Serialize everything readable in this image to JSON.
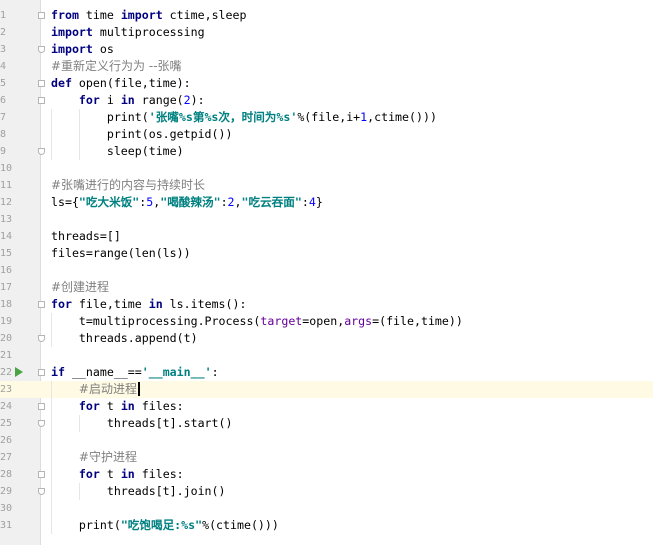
{
  "editor": {
    "lines": [
      {
        "n": "1",
        "tokens": [
          {
            "t": "from",
            "c": "kw"
          },
          {
            "t": " time "
          },
          {
            "t": "import",
            "c": "kw"
          },
          {
            "t": " ctime,sleep"
          }
        ],
        "fold": "start"
      },
      {
        "n": "2",
        "tokens": [
          {
            "t": "import",
            "c": "kw"
          },
          {
            "t": " multiprocessing"
          }
        ]
      },
      {
        "n": "3",
        "tokens": [
          {
            "t": "import",
            "c": "kw"
          },
          {
            "t": " os"
          }
        ],
        "fold": "end"
      },
      {
        "n": "4",
        "tokens": [
          {
            "t": "#重新定义行为为 --张嘴",
            "c": "cmt"
          }
        ]
      },
      {
        "n": "5",
        "tokens": [
          {
            "t": "def",
            "c": "kw"
          },
          {
            "t": " open(file,time):"
          }
        ],
        "fold": "start"
      },
      {
        "n": "6",
        "tokens": [
          {
            "t": "    "
          },
          {
            "t": "for",
            "c": "kw"
          },
          {
            "t": " i "
          },
          {
            "t": "in",
            "c": "kw"
          },
          {
            "t": " range("
          },
          {
            "t": "2",
            "c": "num"
          },
          {
            "t": "):"
          }
        ],
        "fold": "start"
      },
      {
        "n": "7",
        "tokens": [
          {
            "t": "        print("
          },
          {
            "t": "'张嘴%s第%s次，时间为%s'",
            "c": "str"
          },
          {
            "t": "%(file,i+"
          },
          {
            "t": "1",
            "c": "num"
          },
          {
            "t": ",ctime()))"
          }
        ]
      },
      {
        "n": "8",
        "tokens": [
          {
            "t": "        print(os.getpid())"
          }
        ]
      },
      {
        "n": "9",
        "tokens": [
          {
            "t": "        sleep(time)"
          }
        ],
        "fold": "end"
      },
      {
        "n": "10",
        "tokens": []
      },
      {
        "n": "11",
        "tokens": [
          {
            "t": "#张嘴进行的内容与持续时长",
            "c": "cmt"
          }
        ]
      },
      {
        "n": "12",
        "tokens": [
          {
            "t": "ls={"
          },
          {
            "t": "\"吃大米饭\"",
            "c": "str"
          },
          {
            "t": ":"
          },
          {
            "t": "5",
            "c": "num"
          },
          {
            "t": ","
          },
          {
            "t": "\"喝酸辣汤\"",
            "c": "str"
          },
          {
            "t": ":"
          },
          {
            "t": "2",
            "c": "num"
          },
          {
            "t": ","
          },
          {
            "t": "\"吃云吞面\"",
            "c": "str"
          },
          {
            "t": ":"
          },
          {
            "t": "4",
            "c": "num"
          },
          {
            "t": "}"
          }
        ]
      },
      {
        "n": "13",
        "tokens": []
      },
      {
        "n": "14",
        "tokens": [
          {
            "t": "threads=[]"
          }
        ]
      },
      {
        "n": "15",
        "tokens": [
          {
            "t": "files=range(len(ls))"
          }
        ]
      },
      {
        "n": "16",
        "tokens": []
      },
      {
        "n": "17",
        "tokens": [
          {
            "t": "#创建进程",
            "c": "cmt"
          }
        ]
      },
      {
        "n": "18",
        "tokens": [
          {
            "t": "for",
            "c": "kw"
          },
          {
            "t": " file,time "
          },
          {
            "t": "in",
            "c": "kw"
          },
          {
            "t": " ls.items():"
          }
        ],
        "fold": "start"
      },
      {
        "n": "19",
        "tokens": [
          {
            "t": "    t=multiprocessing.Process("
          },
          {
            "t": "target",
            "c": "param"
          },
          {
            "t": "=open,"
          },
          {
            "t": "args",
            "c": "param"
          },
          {
            "t": "=(file,time))"
          }
        ]
      },
      {
        "n": "20",
        "tokens": [
          {
            "t": "    threads.append(t)"
          }
        ],
        "fold": "end"
      },
      {
        "n": "21",
        "tokens": []
      },
      {
        "n": "22",
        "tokens": [
          {
            "t": "if",
            "c": "kw"
          },
          {
            "t": " __name__=="
          },
          {
            "t": "'__main__'",
            "c": "str"
          },
          {
            "t": ":"
          }
        ],
        "run": true,
        "fold": "start"
      },
      {
        "n": "23",
        "tokens": [
          {
            "t": "    "
          },
          {
            "t": "#启动进程",
            "c": "cmt"
          }
        ],
        "current": true,
        "caret": true
      },
      {
        "n": "24",
        "tokens": [
          {
            "t": "    "
          },
          {
            "t": "for",
            "c": "kw"
          },
          {
            "t": " t "
          },
          {
            "t": "in",
            "c": "kw"
          },
          {
            "t": " files:"
          }
        ],
        "fold": "start"
      },
      {
        "n": "25",
        "tokens": [
          {
            "t": "        threads[t].start()"
          }
        ],
        "fold": "end"
      },
      {
        "n": "26",
        "tokens": []
      },
      {
        "n": "27",
        "tokens": [
          {
            "t": "    "
          },
          {
            "t": "#守护进程",
            "c": "cmt"
          }
        ]
      },
      {
        "n": "28",
        "tokens": [
          {
            "t": "    "
          },
          {
            "t": "for",
            "c": "kw"
          },
          {
            "t": " t "
          },
          {
            "t": "in",
            "c": "kw"
          },
          {
            "t": " files:"
          }
        ],
        "fold": "start"
      },
      {
        "n": "29",
        "tokens": [
          {
            "t": "        threads[t].join()"
          }
        ],
        "fold": "end"
      },
      {
        "n": "30",
        "tokens": []
      },
      {
        "n": "31",
        "tokens": [
          {
            "t": "    print("
          },
          {
            "t": "\"吃饱喝足:%s\"",
            "c": "str"
          },
          {
            "t": "%(ctime()))"
          }
        ]
      }
    ]
  }
}
